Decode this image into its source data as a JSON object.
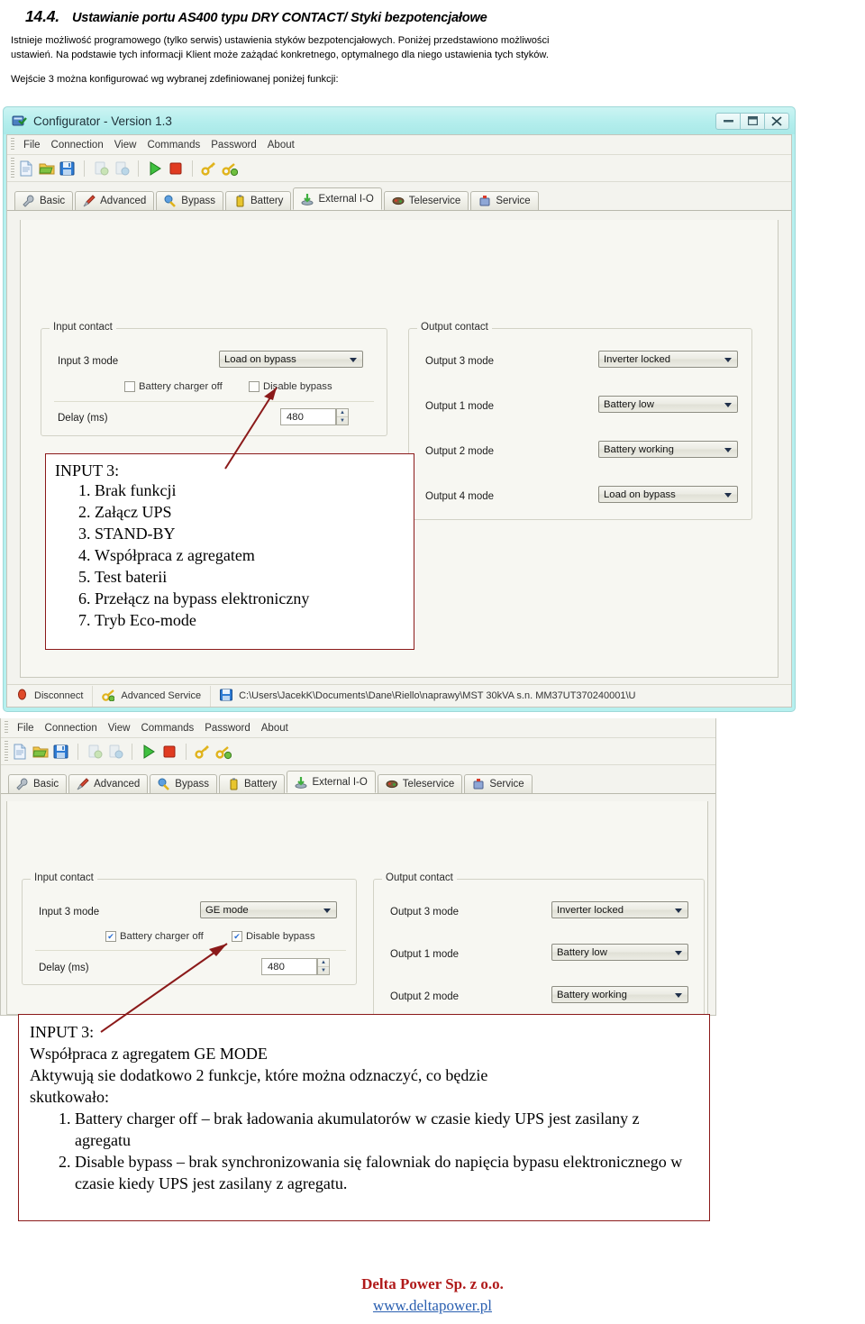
{
  "document": {
    "section_number": "14.4.",
    "title": "Ustawianie portu AS400 typu DRY CONTACT/ Styki bezpotencjałowe",
    "paragraph1_line1": "Istnieje możliwość programowego (tylko serwis) ustawienia styków bezpotencjałowych. Poniżej przedstawiono możliwości",
    "paragraph1_line2": "ustawień. Na podstawie tych informacji Klient może zażądać konkretnego, optymalnego dla niego ustawienia tych styków.",
    "paragraph2": "Wejście 3 można konfigurować wg wybranej zdefiniowanej poniżej funkcji:"
  },
  "app": {
    "title": "Configurator - Version 1.3",
    "title_icon": "app-icon",
    "window_buttons": [
      {
        "name": "minimize-button",
        "glyph": "▬"
      },
      {
        "name": "maximize-button",
        "glyph": "❐"
      },
      {
        "name": "close-button",
        "glyph": "✕"
      }
    ],
    "menu": [
      "File",
      "Connection",
      "View",
      "Commands",
      "Password",
      "About"
    ],
    "toolbar_icons": [
      "new-file-icon",
      "open-folder-icon",
      "save-disk-icon",
      "upload-icon",
      "download-icon",
      "run-icon",
      "stop-icon",
      "key-icon",
      "key-add-icon"
    ],
    "tabs": [
      {
        "label": "Basic",
        "icon": "wrench-icon",
        "active": false
      },
      {
        "label": "Advanced",
        "icon": "screwdriver-icon",
        "active": false
      },
      {
        "label": "Bypass",
        "icon": "bypass-icon",
        "active": false
      },
      {
        "label": "Battery",
        "icon": "battery-icon",
        "active": false
      },
      {
        "label": "External I-O",
        "icon": "external-io-icon",
        "active": true
      },
      {
        "label": "Teleservice",
        "icon": "teleservice-icon",
        "active": false
      },
      {
        "label": "Service",
        "icon": "service-icon",
        "active": false
      }
    ],
    "statusbar": {
      "disconnect_label": "Disconnect",
      "advanced_service_label": "Advanced Service",
      "file_path": "C:\\Users\\JacekK\\Documents\\Dane\\Riello\\naprawy\\MST 30kVA s.n. MM37UT370240001\\U"
    }
  },
  "screen1": {
    "input_group_title": "Input contact",
    "input3_label": "Input 3 mode",
    "input3_value": "Load on bypass",
    "battery_charger_off_label": "Battery charger off",
    "battery_charger_off_checked": false,
    "disable_bypass_label": "Disable bypass",
    "disable_bypass_checked": false,
    "delay_label": "Delay (ms)",
    "delay_value": "480",
    "output_group_title": "Output contact",
    "outputs": [
      {
        "label": "Output 3 mode",
        "value": "Inverter locked"
      },
      {
        "label": "Output 1 mode",
        "value": "Battery low"
      },
      {
        "label": "Output 2 mode",
        "value": "Battery working"
      },
      {
        "label": "Output 4 mode",
        "value": "Load on bypass"
      }
    ]
  },
  "screen2": {
    "input_group_title": "Input contact",
    "input3_label": "Input 3 mode",
    "input3_value": "GE mode",
    "battery_charger_off_label": "Battery charger off",
    "battery_charger_off_checked": true,
    "disable_bypass_label": "Disable bypass",
    "disable_bypass_checked": true,
    "delay_label": "Delay (ms)",
    "delay_value": "480",
    "output_group_title": "Output contact",
    "outputs": [
      {
        "label": "Output 3 mode",
        "value": "Inverter locked"
      },
      {
        "label": "Output 1 mode",
        "value": "Battery low"
      },
      {
        "label": "Output 2 mode",
        "value": "Battery working"
      }
    ]
  },
  "callout1": {
    "title": "INPUT 3:",
    "items": [
      "Brak funkcji",
      "Załącz UPS",
      "STAND-BY",
      "Współpraca z agregatem",
      "Test baterii",
      "Przełącz na bypass elektroniczny",
      "Tryb Eco-mode"
    ]
  },
  "callout2": {
    "title": "INPUT 3:",
    "line1": "Współpraca z agregatem GE MODE",
    "line2": "Aktywują sie dodatkowo 2 funkcje, które można odznaczyć, co będzie",
    "line3": "skutkowało:",
    "items": [
      "Battery charger off – brak ładowania akumulatorów w czasie kiedy UPS jest zasilany z agregatu",
      "Disable bypass – brak synchronizowania się falowniak do napięcia bypasu elektronicznego w czasie kiedy UPS jest zasilany z agregatu."
    ]
  },
  "footer": {
    "company": "Delta Power Sp. z o.o.",
    "website": "www.deltapower.pl"
  },
  "colors": {
    "callout_border": "#8b1a1a",
    "arrow": "#8b1a1a",
    "titlebar": "#b6f0ef",
    "company_red": "#b01a1a",
    "link_blue": "#2a5fb0"
  }
}
